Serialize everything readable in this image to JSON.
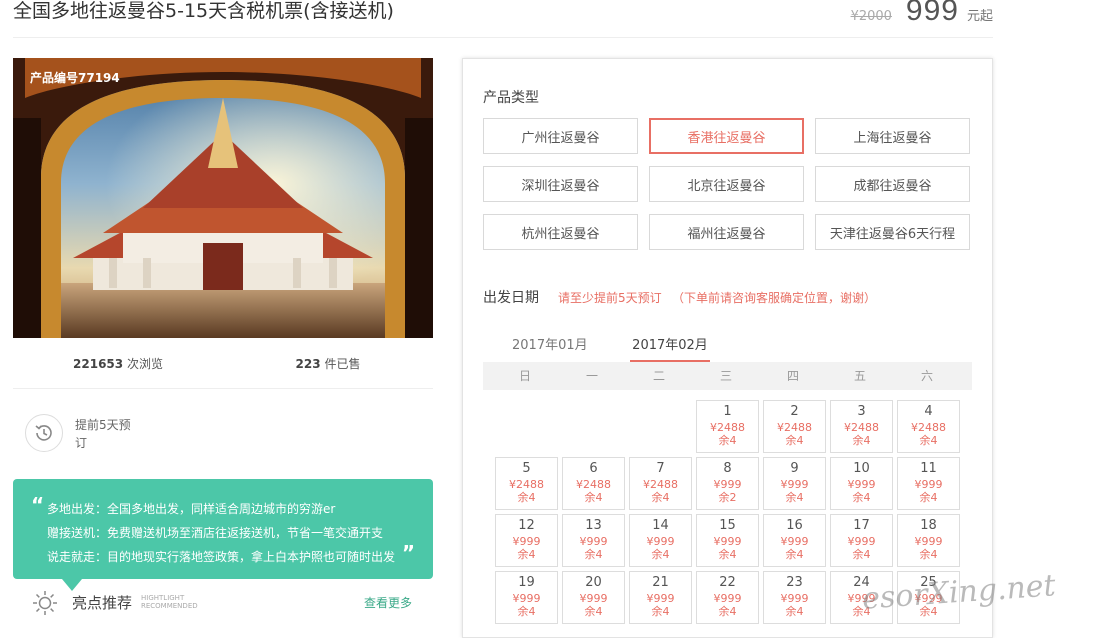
{
  "product": {
    "title": "全国多地往返曼谷5-15天含税机票(含接送机)",
    "old_price": "¥2000",
    "price": "999",
    "price_unit": "元起",
    "code_label": "产品编号77194"
  },
  "stats": {
    "views": "221653",
    "views_label": "次浏览",
    "sold": "223",
    "sold_label": "件已售"
  },
  "advance": {
    "text": "提前5天预订"
  },
  "highlights": {
    "lines": [
      "多地出发：全国多地出发，同样适合周边城市的穷游er",
      "赠接送机：免费赠送机场至酒店往返接送机，节省一笔交通开支",
      "说走就走：目的地现实行落地签政策，拿上白本护照也可随时出发"
    ],
    "title": "亮点推荐",
    "subtitle_1": "HIGHTLIGHT",
    "subtitle_2": "RECOMMENDED",
    "more": "查看更多"
  },
  "product_type": {
    "title": "产品类型",
    "options": [
      "广州往返曼谷",
      "香港往返曼谷",
      "上海往返曼谷",
      "深圳往返曼谷",
      "北京往返曼谷",
      "成都往返曼谷",
      "杭州往返曼谷",
      "福州往返曼谷",
      "天津往返曼谷6天行程"
    ],
    "selected": "香港往返曼谷"
  },
  "departure": {
    "title": "出发日期",
    "note1": "请至少提前5天预订",
    "note2": "（下单前请咨询客服确定位置，谢谢）",
    "months": [
      "2017年01月",
      "2017年02月"
    ],
    "active_month": "2017年02月",
    "weekdays": [
      "日",
      "一",
      "二",
      "三",
      "四",
      "五",
      "六"
    ],
    "days": [
      {
        "d": "1",
        "p": "¥2488",
        "r": "余4"
      },
      {
        "d": "2",
        "p": "¥2488",
        "r": "余4"
      },
      {
        "d": "3",
        "p": "¥2488",
        "r": "余4"
      },
      {
        "d": "4",
        "p": "¥2488",
        "r": "余4"
      },
      {
        "d": "5",
        "p": "¥2488",
        "r": "余4"
      },
      {
        "d": "6",
        "p": "¥2488",
        "r": "余4"
      },
      {
        "d": "7",
        "p": "¥2488",
        "r": "余4"
      },
      {
        "d": "8",
        "p": "¥999",
        "r": "余2"
      },
      {
        "d": "9",
        "p": "¥999",
        "r": "余4"
      },
      {
        "d": "10",
        "p": "¥999",
        "r": "余4"
      },
      {
        "d": "11",
        "p": "¥999",
        "r": "余4"
      },
      {
        "d": "12",
        "p": "¥999",
        "r": "余4"
      },
      {
        "d": "13",
        "p": "¥999",
        "r": "余4"
      },
      {
        "d": "14",
        "p": "¥999",
        "r": "余4"
      },
      {
        "d": "15",
        "p": "¥999",
        "r": "余4"
      },
      {
        "d": "16",
        "p": "¥999",
        "r": "余4"
      },
      {
        "d": "17",
        "p": "¥999",
        "r": "余4"
      },
      {
        "d": "18",
        "p": "¥999",
        "r": "余4"
      },
      {
        "d": "19",
        "p": "¥999",
        "r": "余4"
      },
      {
        "d": "20",
        "p": "¥999",
        "r": "余4"
      },
      {
        "d": "21",
        "p": "¥999",
        "r": "余4"
      },
      {
        "d": "22",
        "p": "¥999",
        "r": "余4"
      },
      {
        "d": "23",
        "p": "¥999",
        "r": "余4"
      },
      {
        "d": "24",
        "p": "¥999",
        "r": "余4"
      },
      {
        "d": "25",
        "p": "¥999",
        "r": "余4"
      }
    ]
  },
  "watermark": "esorXing.net",
  "colors": {
    "accent": "#e86f64",
    "teal": "#4cc7a8"
  },
  "icons": {
    "advance": "clock-history-icon",
    "highlight": "sun-icon",
    "quote": "quote-icon"
  }
}
